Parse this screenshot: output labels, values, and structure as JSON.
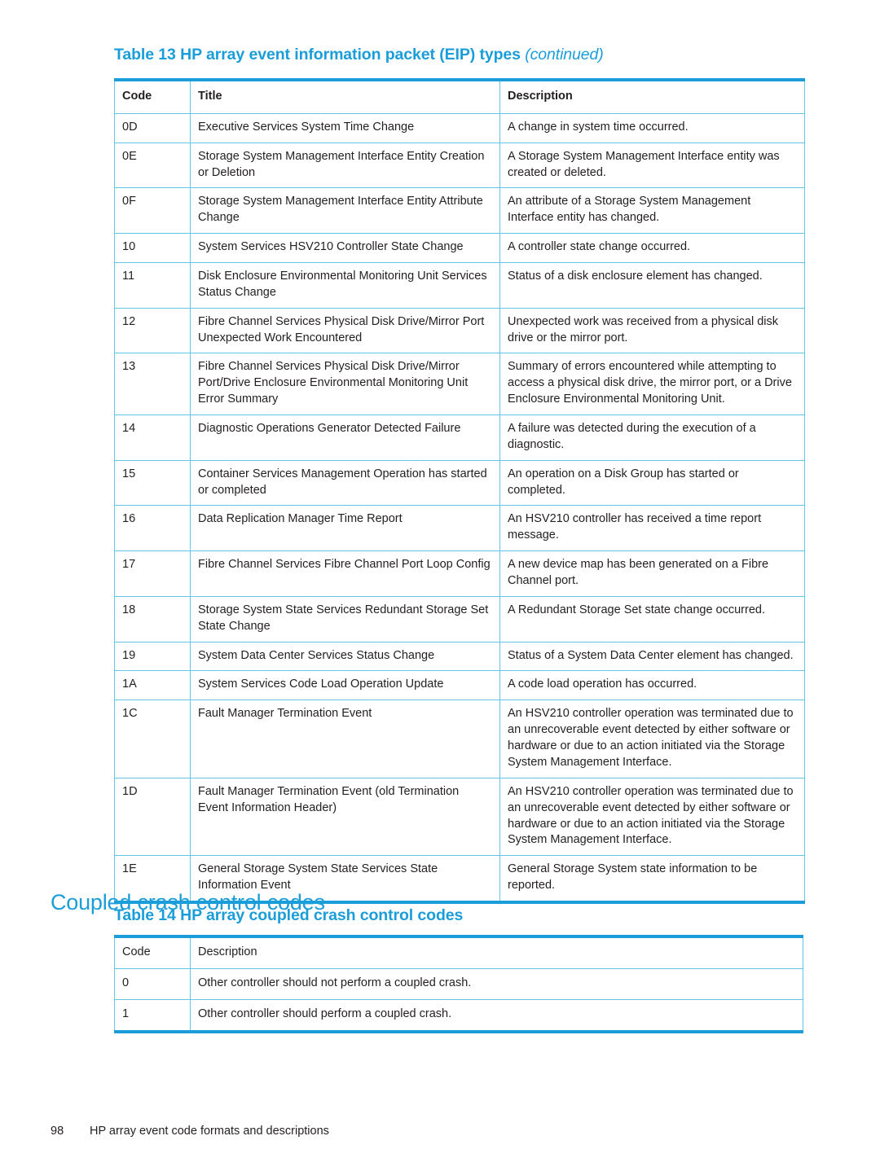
{
  "table13": {
    "caption_main": "Table 13 HP array event information packet (EIP) types",
    "caption_continued": "(continued)",
    "columns": [
      "Code",
      "Title",
      "Description"
    ],
    "rows": [
      {
        "code": "0D",
        "title": "Executive Services System Time Change",
        "description": "A change in system time occurred."
      },
      {
        "code": "0E",
        "title": "Storage System Management Interface Entity Creation or Deletion",
        "description": "A Storage System Management Interface entity was created or deleted."
      },
      {
        "code": "0F",
        "title": "Storage System Management Interface Entity Attribute Change",
        "description": "An attribute of a Storage System Management Interface entity has changed."
      },
      {
        "code": "10",
        "title": "System Services HSV210 Controller State Change",
        "description": "A controller state change occurred."
      },
      {
        "code": "11",
        "title": "Disk Enclosure Environmental Monitoring Unit Services Status Change",
        "description": "Status of a disk enclosure element has changed."
      },
      {
        "code": "12",
        "title": "Fibre Channel Services Physical Disk Drive/Mirror Port Unexpected Work Encountered",
        "description": "Unexpected work was received from a physical disk drive or the mirror port."
      },
      {
        "code": "13",
        "title": "Fibre Channel Services Physical Disk Drive/Mirror Port/Drive Enclosure Environmental Monitoring Unit Error Summary",
        "description": "Summary of errors encountered while attempting to access a physical disk drive, the mirror port, or a Drive Enclosure Environmental Monitoring Unit."
      },
      {
        "code": "14",
        "title": "Diagnostic Operations Generator Detected Failure",
        "description": "A failure was detected during the execution of a diagnostic."
      },
      {
        "code": "15",
        "title": "Container Services Management Operation has started or completed",
        "description": "An operation on a Disk Group has started or completed."
      },
      {
        "code": "16",
        "title": "Data Replication Manager Time Report",
        "description": "An HSV210 controller has received a time report message."
      },
      {
        "code": "17",
        "title": "Fibre Channel Services Fibre Channel Port Loop Config",
        "description": "A new device map has been generated on a Fibre Channel port."
      },
      {
        "code": "18",
        "title": "Storage System State Services Redundant Storage Set State Change",
        "description": "A Redundant Storage Set state change occurred."
      },
      {
        "code": "19",
        "title": "System Data Center Services Status Change",
        "description": "Status of a System Data Center element has changed."
      },
      {
        "code": "1A",
        "title": "System Services Code Load Operation Update",
        "description": "A code load operation has occurred."
      },
      {
        "code": "1C",
        "title": "Fault Manager Termination Event",
        "description": "An HSV210 controller operation was terminated due to an unrecoverable event detected by either software or hardware or due to an action initiated via the Storage System Management Interface."
      },
      {
        "code": "1D",
        "title": "Fault Manager Termination Event (old Termination Event Information Header)",
        "description": "An HSV210 controller operation was terminated due to an unrecoverable event detected by either software or hardware or due to an action initiated via the Storage System Management Interface."
      },
      {
        "code": "1E",
        "title": "General Storage System State Services State Information Event",
        "description": "General Storage System state information to be reported."
      }
    ]
  },
  "section": {
    "heading": "Coupled crash control codes"
  },
  "table14": {
    "caption_main": "Table 14 HP array coupled crash control codes",
    "columns": [
      "Code",
      "Description"
    ],
    "rows": [
      {
        "code": "0",
        "description": "Other controller should not perform a coupled crash."
      },
      {
        "code": "1",
        "description": "Other controller should perform a coupled crash."
      }
    ]
  },
  "footer": {
    "page_number": "98",
    "chapter_title": "HP array event code formats and descriptions"
  },
  "colors": {
    "accent": "#1b9dd9",
    "rule": "#64c4e8",
    "text": "#231f20"
  }
}
